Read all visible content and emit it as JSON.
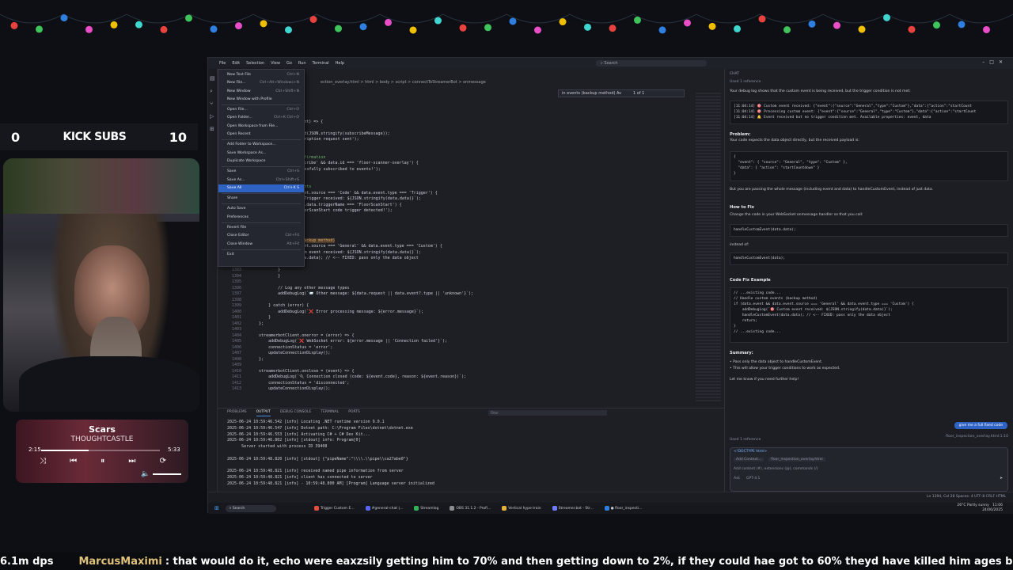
{
  "overlay": {
    "subs_left": "0",
    "subs_title": "KICK SUBS",
    "subs_right": "10",
    "music": {
      "title": "Scars",
      "artist": "THOUGHTCASTLE",
      "elapsed": "2:15",
      "duration": "5:33",
      "progress": 0.4
    }
  },
  "vscode": {
    "menubar": [
      "File",
      "Edit",
      "Selection",
      "View",
      "Go",
      "Run",
      "Terminal",
      "Help"
    ],
    "search_placeholder": "Search",
    "breadcrumb": "ection_overlay.html > html > body > script > connectToStreamerBot > onmessage",
    "find_query": "in events (backup method) Av",
    "find_count": "1 of 1",
    "file_menu": [
      {
        "label": "New Text File",
        "key": "Ctrl+N"
      },
      {
        "label": "New File...",
        "key": "Ctrl+Alt+Windows+N"
      },
      {
        "label": "New Window",
        "key": "Ctrl+Shift+N"
      },
      {
        "label": "New Window with Profile",
        "key": ""
      },
      {
        "sep": true
      },
      {
        "label": "Open File...",
        "key": "Ctrl+O"
      },
      {
        "label": "Open Folder...",
        "key": "Ctrl+K Ctrl+O"
      },
      {
        "label": "Open Workspace from File...",
        "key": ""
      },
      {
        "label": "Open Recent",
        "key": ""
      },
      {
        "sep": true
      },
      {
        "label": "Add Folder to Workspace...",
        "key": ""
      },
      {
        "label": "Save Workspace As...",
        "key": ""
      },
      {
        "label": "Duplicate Workspace",
        "key": ""
      },
      {
        "sep": true
      },
      {
        "label": "Save",
        "key": "Ctrl+S"
      },
      {
        "label": "Save As...",
        "key": "Ctrl+Shift+S"
      },
      {
        "label": "Save All",
        "key": "Ctrl+K S",
        "selected": true
      },
      {
        "sep": true
      },
      {
        "label": "Share",
        "key": ""
      },
      {
        "sep": true
      },
      {
        "label": "Auto Save",
        "key": ""
      },
      {
        "label": "Preferences",
        "key": ""
      },
      {
        "sep": true
      },
      {
        "label": "Revert File",
        "key": ""
      },
      {
        "label": "Close Editor",
        "key": "Ctrl+F4"
      },
      {
        "label": "Close Window",
        "key": "Alt+F4"
      },
      {
        "sep": true
      },
      {
        "label": "Exit",
        "key": ""
      }
    ],
    "code_lines": [
      {
        "n": "",
        "t": "treamerBot() {"
      },
      {
        "n": "",
        "t": "Client.onmessage = (event) => {"
      },
      {
        "n": "",
        "t": ""
      },
      {
        "n": "",
        "t": "  streamerbotClient.send(JSON.stringify(subscribeMessage));"
      },
      {
        "n": "",
        "t": "  addDebugLog('📡 Subscription request sent');"
      },
      {
        "n": "",
        "t": "  return;"
      },
      {
        "n": "",
        "t": ""
      },
      {
        "n": "",
        "t": "Handle subscription confirmation",
        "c": "c1"
      },
      {
        "n": "",
        "t": "(data.request === 'Subscribe' && data.id === 'floor-scanner-overlay') {"
      },
      {
        "n": "",
        "t": "  addDebugLog('✅ Successfully subscribed to events!');"
      },
      {
        "n": "",
        "t": "  return;"
      },
      {
        "n": "",
        "t": ""
      },
      {
        "n": "",
        "t": "Handle Code trigger events",
        "c": "c1"
      },
      {
        "n": "",
        "t": "(data.event && data.event.source === 'Code' && data.event.type === 'Trigger') {"
      },
      {
        "n": "",
        "t": "  addDebugLog(`🎯 Code Trigger received: ${JSON.stringify(data.data)}`);"
      },
      {
        "n": "",
        "t": "  if (data.data && data.data.triggerName === 'FloorScanStart') {"
      },
      {
        "n": "",
        "t": "    addDebugLog('🎯 FloorScanStart code trigger detected!');"
      },
      {
        "n": "",
        "t": "    startCountdown();"
      },
      {
        "n": "",
        "t": "  }"
      },
      {
        "n": "",
        "t": "  return;"
      },
      {
        "n": "",
        "t": ""
      },
      {
        "n": "",
        "t": "Handle custom events (backup method)",
        "c": "c2"
      },
      {
        "n": "",
        "t": "(data.event && data.event.source === 'General' && data.event.type === 'Custom') {"
      },
      {
        "n": "",
        "t": "  addDebugLog(`🎯 Custom event received: ${JSON.stringify(data.data)}`);"
      },
      {
        "n": "",
        "t": "  handleCustomEvent(data.data); // <-- FIXED: pass only the data object"
      },
      {
        "n": "",
        "t": "  return;"
      },
      {
        "n": "1393",
        "t": "            }"
      },
      {
        "n": "1394",
        "t": "            }"
      },
      {
        "n": "1395",
        "t": ""
      },
      {
        "n": "1396",
        "t": "            // Log any other message types"
      },
      {
        "n": "1397",
        "t": "            addDebugLog(`📨 Other message: ${data.request || data.event?.type || 'unknown'}`);"
      },
      {
        "n": "1398",
        "t": ""
      },
      {
        "n": "1399",
        "t": "        } catch (error) {"
      },
      {
        "n": "1400",
        "t": "            addDebugLog(`❌ Error processing message: ${error.message}`);"
      },
      {
        "n": "1401",
        "t": "        }"
      },
      {
        "n": "1402",
        "t": "    };"
      },
      {
        "n": "1403",
        "t": ""
      },
      {
        "n": "1404",
        "t": "    streamerbotClient.onerror = (error) => {"
      },
      {
        "n": "1405",
        "t": "        addDebugLog(`❌ WebSocket error: ${error.message || 'Connection failed'}`);"
      },
      {
        "n": "1406",
        "t": "        connectionStatus = 'error';"
      },
      {
        "n": "1407",
        "t": "        updateConnectionDisplay();"
      },
      {
        "n": "1408",
        "t": "    };"
      },
      {
        "n": "1409",
        "t": ""
      },
      {
        "n": "1410",
        "t": "    streamerbotClient.onclose = (event) => {"
      },
      {
        "n": "1411",
        "t": "        addDebugLog(`🔌 Connection closed (code: ${event.code}, reason: ${event.reason})`);"
      },
      {
        "n": "1412",
        "t": "        connectionStatus = 'disconnected';"
      },
      {
        "n": "1413",
        "t": "        updateConnectionDisplay();"
      }
    ],
    "panel_tabs": [
      "PROBLEMS",
      "OUTPUT",
      "DEBUG CONSOLE",
      "TERMINAL",
      "PORTS"
    ],
    "panel_active": "OUTPUT",
    "panel_filter": "Filter",
    "output_lines": [
      "2025-06-24 10:59:46.542 [info] Locating .NET runtime version 9.0.1",
      "2025-06-24 10:59:46.547 [info] Dotnet path: C:\\Program Files\\dotnet\\dotnet.exe",
      "2025-06-24 10:59:46.553 [info] Activating C# + C# Dev Kit...",
      "2025-06-24 10:59:46.802 [info] [stdout] info: Program[0]",
      "      Server started with process ID 39408",
      "",
      "2025-06-24 10:59:48.820 [info] [stdout] {\"pipeName\":\"\\\\\\\\.\\\\pipe\\\\ca27abe0\"}",
      "",
      "2025-06-24 10:59:48.821 [info] received named pipe information from server",
      "2025-06-24 10:59:48.821 [info] client has connected to server",
      "2025-06-24 10:59:48.821 [info] - 10:59:48.800 AM] [Program] Language server initialized"
    ],
    "chat": {
      "header": "CHAT",
      "ref": "Used 1 reference",
      "intro": "Your debug log shows that the custom event is being received, but the trigger condition is not met:",
      "log": "[11:04:14] 🎯 Custom event received: {\"event\":{\"source\":\"General\",\"type\":\"Custom\"},\"data\":{\"action\":\"startCount\n[11:04:14] 🎯 Processing custom event: {\"event\":{\"source\":\"General\",\"type\":\"Custom\"},\"data\":{\"action\":\"startCount\n[11:04:14] 🔔 Event received but no trigger condition met. Available properties: event, data",
      "problem_h": "Problem:",
      "problem": "Your code expects the data object directly, but the received payload is:",
      "payload": "{\n  \"event\": { \"source\": \"General\", \"type\": \"Custom\" },\n  \"data\": { \"action\": \"startCountdown\" }\n}",
      "passing": "But you are passing the whole message (including event and data) to handleCustomEvent, instead of just data.",
      "howto_h": "How to Fix",
      "howto": "Change the code in your WebSocket onmessage handler so that you call:",
      "fix1": "handleCustomEvent(data.data);",
      "instead": "instead of:",
      "fix2": "handleCustomEvent(data);",
      "example_h": "Code Fix Example",
      "example": "// ...existing code...\n// Handle custom events (backup method)\nif (data.event && data.event.source === 'General' && data.event.type === 'Custom') {\n    addDebugLog(`🎯 Custom event received: ${JSON.stringify(data.data)}`);\n    handleCustomEvent(data.data); // <-- FIXED: pass only the data object\n    return;\n}\n// ...existing code...",
      "summary_h": "Summary:",
      "summary1": "• Pass only the data object to handleCustomEvent.",
      "summary2": "• This will allow your trigger conditions to work as expected.",
      "closing": "Let me know if you need further help!",
      "user_msg": "give me a full fixed code",
      "file_ref": "floor_inspection_overlay.html:1:10",
      "ref2": "Used 1 reference",
      "doctype": "<!DOCTYPE html>",
      "add_context": "Add Context...",
      "attached": "floor_inspection_overlay.html",
      "input_placeholder": "Add context (#), extensions (@), commands (/)",
      "mode": "Ask",
      "model": "GPT-4.1"
    },
    "status_right": "Ln 1394, Col 28   Spaces: 4   UTF-8   CRLF   HTML",
    "taskbar": {
      "search": "Search",
      "apps": [
        {
          "label": "Trigger Custom E...",
          "color": "#e94c3d"
        },
        {
          "label": "#general-chat |...",
          "color": "#5865f2"
        },
        {
          "label": "Streamlog",
          "color": "#2fb35a"
        },
        {
          "label": "OBS 31.1.2 - Profi...",
          "color": "#8d8d8d"
        },
        {
          "label": "Vertical hype train",
          "color": "#e2b23a"
        },
        {
          "label": "Streamer.bot - Str...",
          "color": "#6f7dff"
        },
        {
          "label": "● floor_inspecti...",
          "color": "#2f7fe0"
        }
      ],
      "weather": "26°C",
      "weather_desc": "Partly sunny",
      "time": "11:06",
      "date": "24/06/2025"
    }
  },
  "ticker": {
    "lead": "6.1m dps",
    "name": "MarcusMaximi",
    "message": ": that would do it, echo were eaxzsily getting him to 70% and then getting down to 2%, if they could hae got to 60% theyd have killed him ages before"
  }
}
